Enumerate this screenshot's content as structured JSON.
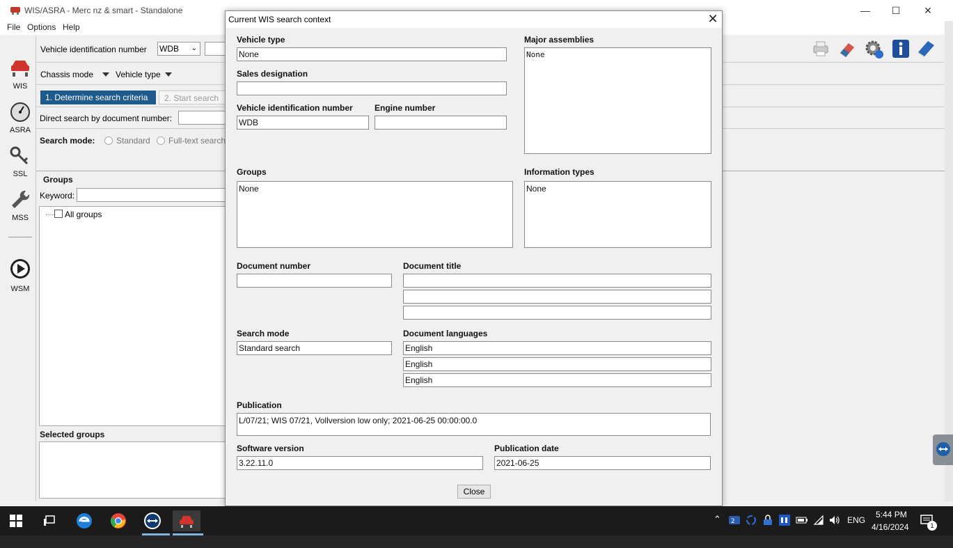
{
  "window": {
    "title": "WIS/ASRA - Merc          nz & smart - Standalone"
  },
  "menu": [
    "File",
    "Options",
    "Help"
  ],
  "rail": [
    {
      "label": "WIS",
      "icon": "car-lift-icon"
    },
    {
      "label": "ASRA",
      "icon": "stopwatch-icon"
    },
    {
      "label": "SSL",
      "icon": "key-icon"
    },
    {
      "label": "MSS",
      "icon": "wrench-icon"
    },
    {
      "label": "WSM",
      "icon": "play-icon"
    }
  ],
  "main": {
    "vin_label": "Vehicle identification number",
    "vin_prefix": "WDB",
    "chassis_mode": "Chassis mode",
    "vehicle_type": "Vehicle type",
    "step1": "1. Determine search criteria",
    "step2": "2. Start search",
    "direct_search_label": "Direct search by document number:",
    "search_mode_label": "Search mode:",
    "search_mode_standard": "Standard",
    "search_mode_fulltext": "Full-text search",
    "groups_heading": "Groups",
    "keyword_label": "Keyword:",
    "all_groups": "All groups",
    "selected_groups": "Selected groups"
  },
  "dialog": {
    "title": "Current WIS search context",
    "vehicle_type_label": "Vehicle type",
    "vehicle_type_value": "None",
    "sales_designation_label": "Sales designation",
    "sales_designation_value": "",
    "vin_label": "Vehicle identification number",
    "vin_value": "WDB",
    "engine_number_label": "Engine number",
    "engine_number_value": "",
    "major_assemblies_label": "Major assemblies",
    "major_assemblies_value": "None",
    "groups_label": "Groups",
    "groups_value": "None",
    "information_types_label": "Information types",
    "information_types_value": "None",
    "document_number_label": "Document number",
    "document_title_label": "Document title",
    "search_mode_label": "Search mode",
    "search_mode_value": "Standard search",
    "document_languages_label": "Document languages",
    "document_languages": [
      "English",
      "English",
      "English"
    ],
    "publication_label": "Publication",
    "publication_value": "L/07/21; WIS 07/21, Vollversion low only; 2021-06-25 00:00:00.0",
    "software_version_label": "Software version",
    "software_version_value": "3.22.11.0",
    "publication_date_label": "Publication date",
    "publication_date_value": "2021-06-25",
    "close_button": "Close"
  },
  "taskbar": {
    "language": "ENG",
    "time": "5:44 PM",
    "date": "4/16/2024",
    "notification_count": "1"
  },
  "colors": {
    "step_active": "#1e5a8c",
    "taskbar": "#1b1b1b",
    "accent_underline": "#7fb2e5"
  }
}
